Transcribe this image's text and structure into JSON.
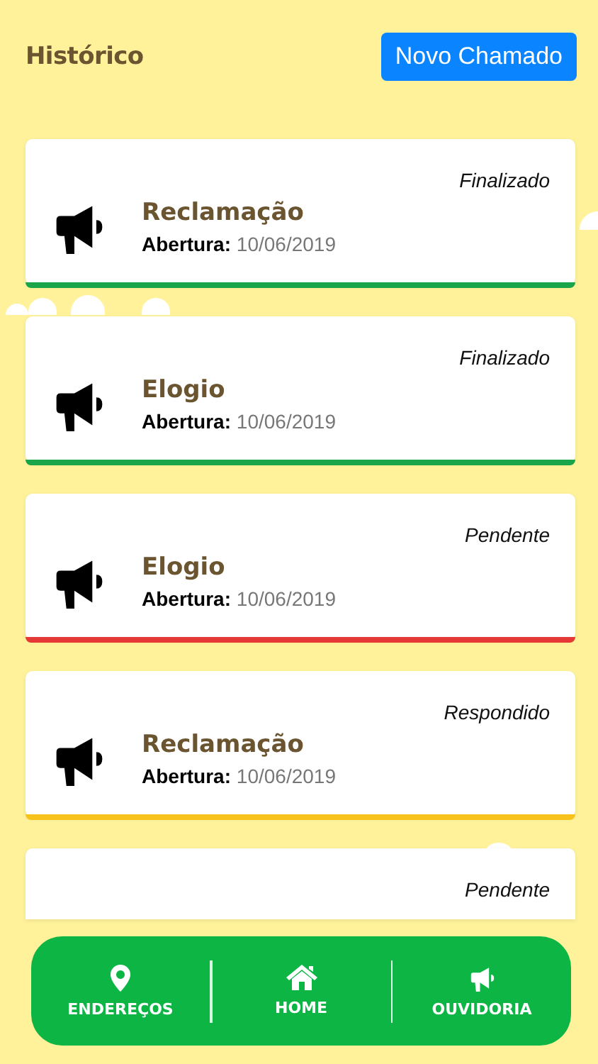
{
  "header": {
    "title": "Histórico",
    "new_button": "Novo Chamado"
  },
  "tickets": [
    {
      "title": "Reclamação",
      "opening_label": "Abertura:",
      "date": "10/06/2019",
      "status": "Finalizado",
      "color": "#1aa54a"
    },
    {
      "title": "Elogio",
      "opening_label": "Abertura:",
      "date": "10/06/2019",
      "status": "Finalizado",
      "color": "#1aa54a"
    },
    {
      "title": "Elogio",
      "opening_label": "Abertura:",
      "date": "10/06/2019",
      "status": "Pendente",
      "color": "#e53935"
    },
    {
      "title": "Reclamação",
      "opening_label": "Abertura:",
      "date": "10/06/2019",
      "status": "Respondido",
      "color": "#f7c21b"
    },
    {
      "kind": "partial",
      "status": "Pendente"
    }
  ],
  "nav": [
    {
      "kind": "pin",
      "label": "ENDEREÇOS"
    },
    {
      "kind": "home",
      "label": "HOME"
    },
    {
      "kind": "megaphone",
      "label": "OUVIDORIA"
    }
  ]
}
